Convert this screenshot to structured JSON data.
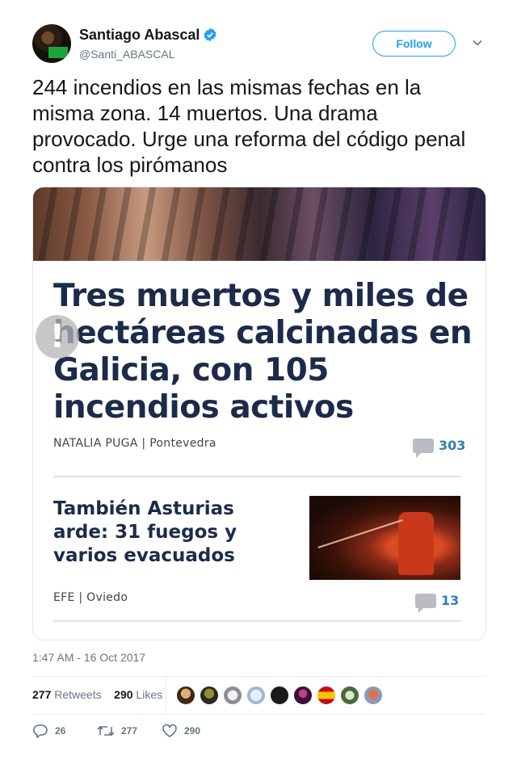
{
  "author": {
    "name": "Santiago Abascal",
    "handle": "@Santi_ABASCAL",
    "verified": true
  },
  "follow_label": "Follow",
  "tweet_text": "244 incendios en las mismas fechas en la misma zona. 14 muertos. Una drama provocado. Urge una reforma del código penal contra los pirómanos",
  "media": {
    "info_glyph": "!",
    "headline1": "Tres muertos y miles de hectáreas calcinadas en Galicia, con 105 incendios activos",
    "byline1": "NATALIA PUGA | Pontevedra",
    "comments1": "303",
    "headline2": "También Asturias arde: 31 fuegos y varios evacuados",
    "byline2": "EFE | Oviedo",
    "comments2": "13"
  },
  "timestamp": "1:47 AM - 16 Oct 2017",
  "stats": {
    "retweets_count": "277",
    "retweets_label": "Retweets",
    "likes_count": "290",
    "likes_label": "Likes"
  },
  "actions": {
    "reply_count": "26",
    "retweet_count": "277",
    "like_count": "290"
  },
  "colors": {
    "accent": "#1da1f2",
    "text": "#14171a",
    "muted": "#657786",
    "headline_navy": "#1c2b4a",
    "comment_blue": "#2f7fb8"
  },
  "icons": [
    "verified-badge-icon",
    "caret-down-icon",
    "reply-icon",
    "retweet-icon",
    "like-icon",
    "comment-bubble-icon"
  ]
}
